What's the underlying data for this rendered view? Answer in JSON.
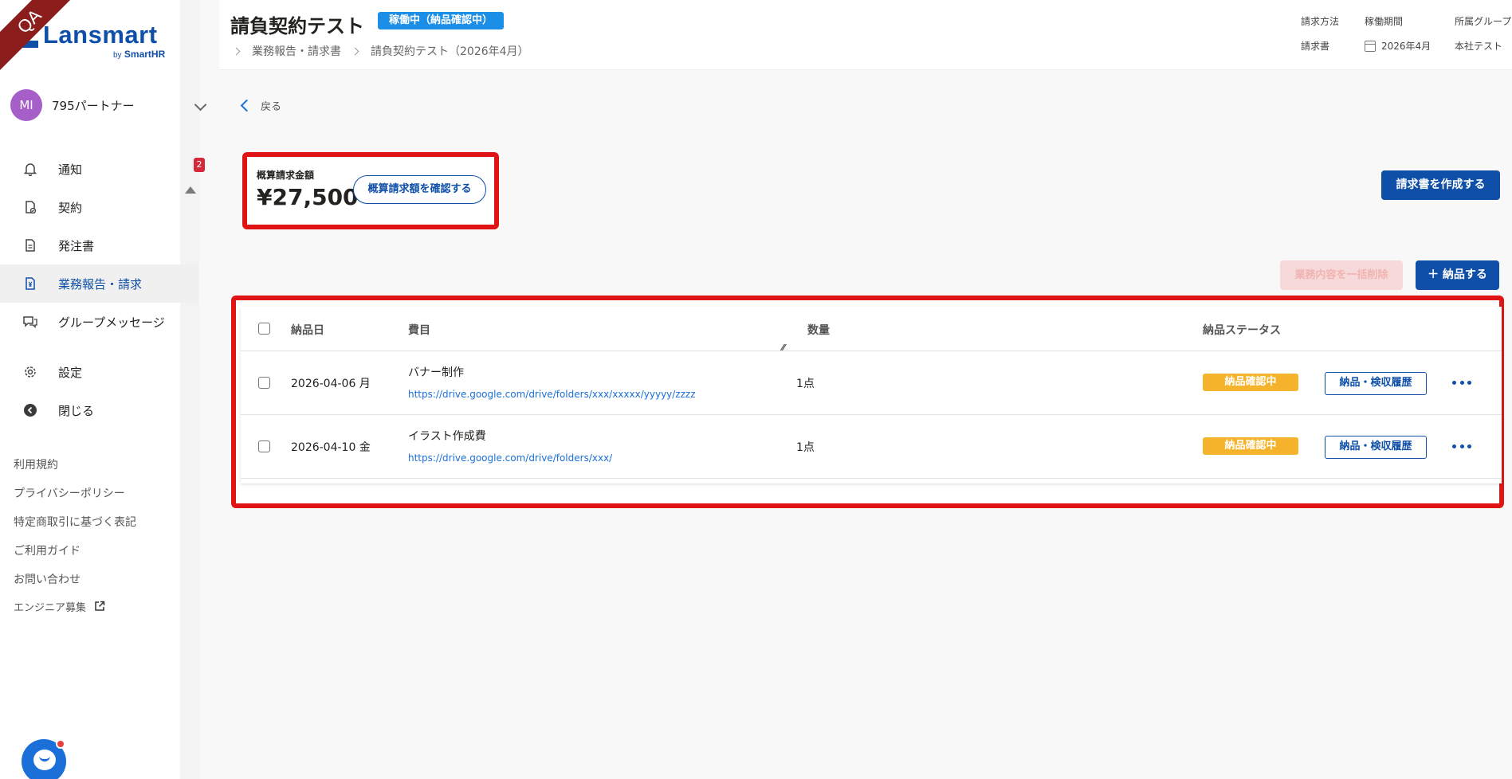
{
  "ribbon": {
    "text": "QA"
  },
  "brand": {
    "name": "Lansmart",
    "by": "by",
    "sub": "SmartHR"
  },
  "account": {
    "initials": "MI",
    "name": "795パートナー"
  },
  "sidebar": {
    "items": [
      {
        "label": "通知",
        "icon": "bell-icon",
        "badge": "2"
      },
      {
        "label": "契約",
        "icon": "contract-icon"
      },
      {
        "label": "発注書",
        "icon": "document-icon"
      },
      {
        "label": "業務報告・請求",
        "icon": "yen-document-icon",
        "active": true
      },
      {
        "label": "グループメッセージ",
        "icon": "chat-icon"
      },
      {
        "label": "設定",
        "icon": "gear-icon"
      },
      {
        "label": "閉じる",
        "icon": "collapse-icon"
      }
    ],
    "footer": [
      "利用規約",
      "プライバシーポリシー",
      "特定商取引に基づく表記",
      "ご利用ガイド",
      "お問い合わせ",
      "エンジニア募集"
    ]
  },
  "header": {
    "title": "請負契約テスト",
    "status": "稼働中（納品確認中）",
    "breadcrumb": [
      "業務報告・請求書",
      "請負契約テスト（2026年4月）"
    ],
    "meta": [
      {
        "label": "請求方法",
        "value": "請求書"
      },
      {
        "label": "稼働期間",
        "value": "2026年4月"
      },
      {
        "label": "所属グループ",
        "value": "本社テスト"
      }
    ]
  },
  "main": {
    "back": "戻る",
    "amount_label": "概算請求金額",
    "amount_value": "¥27,500",
    "amount_button": "概算請求額を確認する",
    "create_invoice": "請求書を作成する",
    "bulk_delete": "業務内容を一括削除",
    "deliver": "＋ 納品する"
  },
  "table": {
    "headers": {
      "date": "納品日",
      "item": "費目",
      "qty": "数量",
      "status": "納品ステータス"
    },
    "rows": [
      {
        "date": "2026-04-06 月",
        "item": "バナー制作",
        "link": "https://drive.google.com/drive/folders/xxx/xxxxx/yyyyy/zzzz",
        "qty": "1点",
        "status": "納品確認中",
        "history": "納品・検収履歴"
      },
      {
        "date": "2026-04-10 金",
        "item": "イラスト作成費",
        "link": "https://drive.google.com/drive/folders/xxx/",
        "qty": "1点",
        "status": "納品確認中",
        "history": "納品・検収履歴"
      }
    ]
  },
  "colors": {
    "brand": "#0f4fa8",
    "accent": "#1b8ee8",
    "warning": "#f5b32c",
    "highlight": "#e01414"
  }
}
